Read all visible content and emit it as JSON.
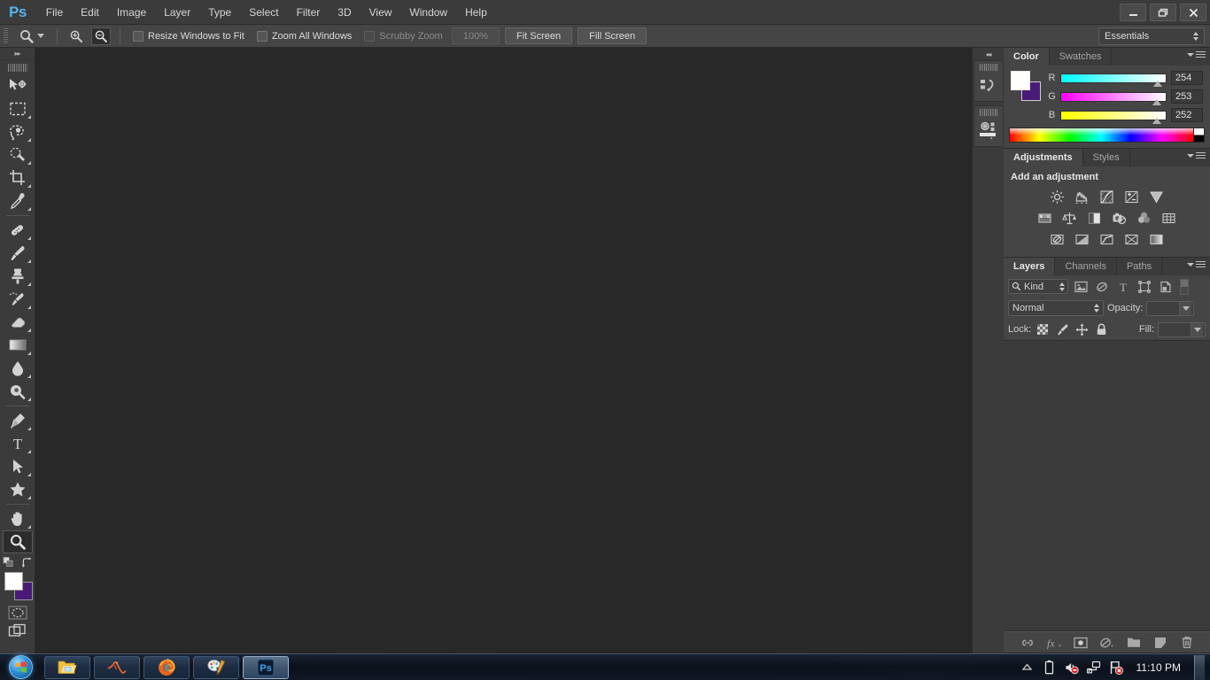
{
  "app": {
    "logo": "Ps",
    "menus": [
      "File",
      "Edit",
      "Image",
      "Layer",
      "Type",
      "Select",
      "Filter",
      "3D",
      "View",
      "Window",
      "Help"
    ],
    "window_controls": [
      {
        "name": "minimize",
        "glyph": "—"
      },
      {
        "name": "restore",
        "glyph": "❐"
      },
      {
        "name": "close",
        "glyph": "✕"
      }
    ]
  },
  "options_bar": {
    "tool_icon": "zoom-tool-icon",
    "zoom_in_icon": "zoom-in-icon",
    "zoom_out_icon": "zoom-out-icon",
    "checkboxes": [
      {
        "label": "Resize Windows to Fit",
        "checked": false,
        "disabled": false
      },
      {
        "label": "Zoom All Windows",
        "checked": false,
        "disabled": false
      },
      {
        "label": "Scrubby Zoom",
        "checked": false,
        "disabled": true
      }
    ],
    "buttons": [
      {
        "label": "100%",
        "disabled": true
      },
      {
        "label": "Fit Screen",
        "disabled": false
      },
      {
        "label": "Fill Screen",
        "disabled": false
      }
    ],
    "workspace": "Essentials"
  },
  "toolbar": {
    "collapse_glyph": "▸▸",
    "tools": [
      {
        "name": "move-tool",
        "has_flyout": false
      },
      {
        "name": "rectangular-marquee-tool",
        "has_flyout": true
      },
      {
        "name": "lasso-tool",
        "has_flyout": true
      },
      {
        "name": "quick-selection-tool",
        "has_flyout": true
      },
      {
        "name": "crop-tool",
        "has_flyout": true
      },
      {
        "name": "eyedropper-tool",
        "has_flyout": true
      },
      {
        "name": "spot-healing-brush-tool",
        "has_flyout": true
      },
      {
        "name": "brush-tool",
        "has_flyout": true
      },
      {
        "name": "clone-stamp-tool",
        "has_flyout": true
      },
      {
        "name": "history-brush-tool",
        "has_flyout": true
      },
      {
        "name": "eraser-tool",
        "has_flyout": true
      },
      {
        "name": "gradient-tool",
        "has_flyout": true
      },
      {
        "name": "blur-tool",
        "has_flyout": true
      },
      {
        "name": "dodge-tool",
        "has_flyout": true
      },
      {
        "name": "pen-tool",
        "has_flyout": true
      },
      {
        "name": "horizontal-type-tool",
        "has_flyout": true
      },
      {
        "name": "path-selection-tool",
        "has_flyout": true
      },
      {
        "name": "custom-shape-tool",
        "has_flyout": true
      },
      {
        "name": "hand-tool",
        "has_flyout": true
      },
      {
        "name": "zoom-tool",
        "has_flyout": false,
        "selected": true
      }
    ],
    "foreground_color": "#fffefc",
    "background_color": "#4a1a78",
    "quick_mask_icon": "quick-mask-icon",
    "screen_mode_icon": "screen-mode-icon"
  },
  "dock_strip": {
    "collapse_glyph": "◂◂",
    "icons": [
      "history-panel-icon",
      "properties-panel-icon"
    ]
  },
  "color_panel": {
    "tabs": [
      {
        "label": "Color",
        "active": true
      },
      {
        "label": "Swatches",
        "active": false
      }
    ],
    "foreground_color": "#fffefc",
    "background_color": "#4a1a78",
    "sliders": [
      {
        "label": "R",
        "value": "254",
        "pos": 98
      },
      {
        "label": "G",
        "value": "253",
        "pos": 97
      },
      {
        "label": "B",
        "value": "252",
        "pos": 97
      }
    ]
  },
  "adjustments_panel": {
    "tabs": [
      {
        "label": "Adjustments",
        "active": true
      },
      {
        "label": "Styles",
        "active": false
      }
    ],
    "title": "Add an adjustment",
    "rows": [
      [
        "brightness-contrast-icon",
        "levels-icon",
        "curves-icon",
        "exposure-icon",
        "vibrance-icon"
      ],
      [
        "hue-saturation-icon",
        "color-balance-icon",
        "black-white-icon",
        "photo-filter-icon",
        "channel-mixer-icon",
        "color-lookup-icon"
      ],
      [
        "invert-icon",
        "posterize-icon",
        "threshold-icon",
        "selective-color-icon",
        "gradient-map-icon"
      ]
    ]
  },
  "layers_panel": {
    "tabs": [
      {
        "label": "Layers",
        "active": true
      },
      {
        "label": "Channels",
        "active": false
      },
      {
        "label": "Paths",
        "active": false
      }
    ],
    "filter_kind": "Kind",
    "filter_icons": [
      "filter-pixel-icon",
      "filter-adjustment-icon",
      "filter-type-icon",
      "filter-shape-icon",
      "filter-smart-object-icon"
    ],
    "blend_mode": "Normal",
    "opacity_label": "Opacity:",
    "opacity_value": "",
    "lock_label": "Lock:",
    "lock_icons": [
      "lock-transparent-pixels-icon",
      "lock-image-pixels-icon",
      "lock-position-icon",
      "lock-all-icon"
    ],
    "fill_label": "Fill:",
    "fill_value": "",
    "footer_icons": [
      "link-layers-icon",
      "layer-style-fx-icon",
      "add-layer-mask-icon",
      "new-adjustment-layer-icon",
      "new-group-icon",
      "new-layer-icon",
      "delete-layer-icon"
    ]
  },
  "taskbar": {
    "start_icon": "windows-start-orb-icon",
    "apps": [
      {
        "name": "file-explorer",
        "active": false
      },
      {
        "name": "matlab",
        "active": false
      },
      {
        "name": "firefox",
        "active": false
      },
      {
        "name": "paint",
        "active": false
      },
      {
        "name": "photoshop",
        "active": true,
        "label": "Ps"
      }
    ],
    "tray": [
      {
        "name": "show-hidden-icons-icon"
      },
      {
        "name": "battery-icon"
      },
      {
        "name": "volume-muted-icon"
      },
      {
        "name": "network-icon"
      },
      {
        "name": "action-center-error-icon"
      }
    ],
    "clock": "11:10 PM"
  }
}
